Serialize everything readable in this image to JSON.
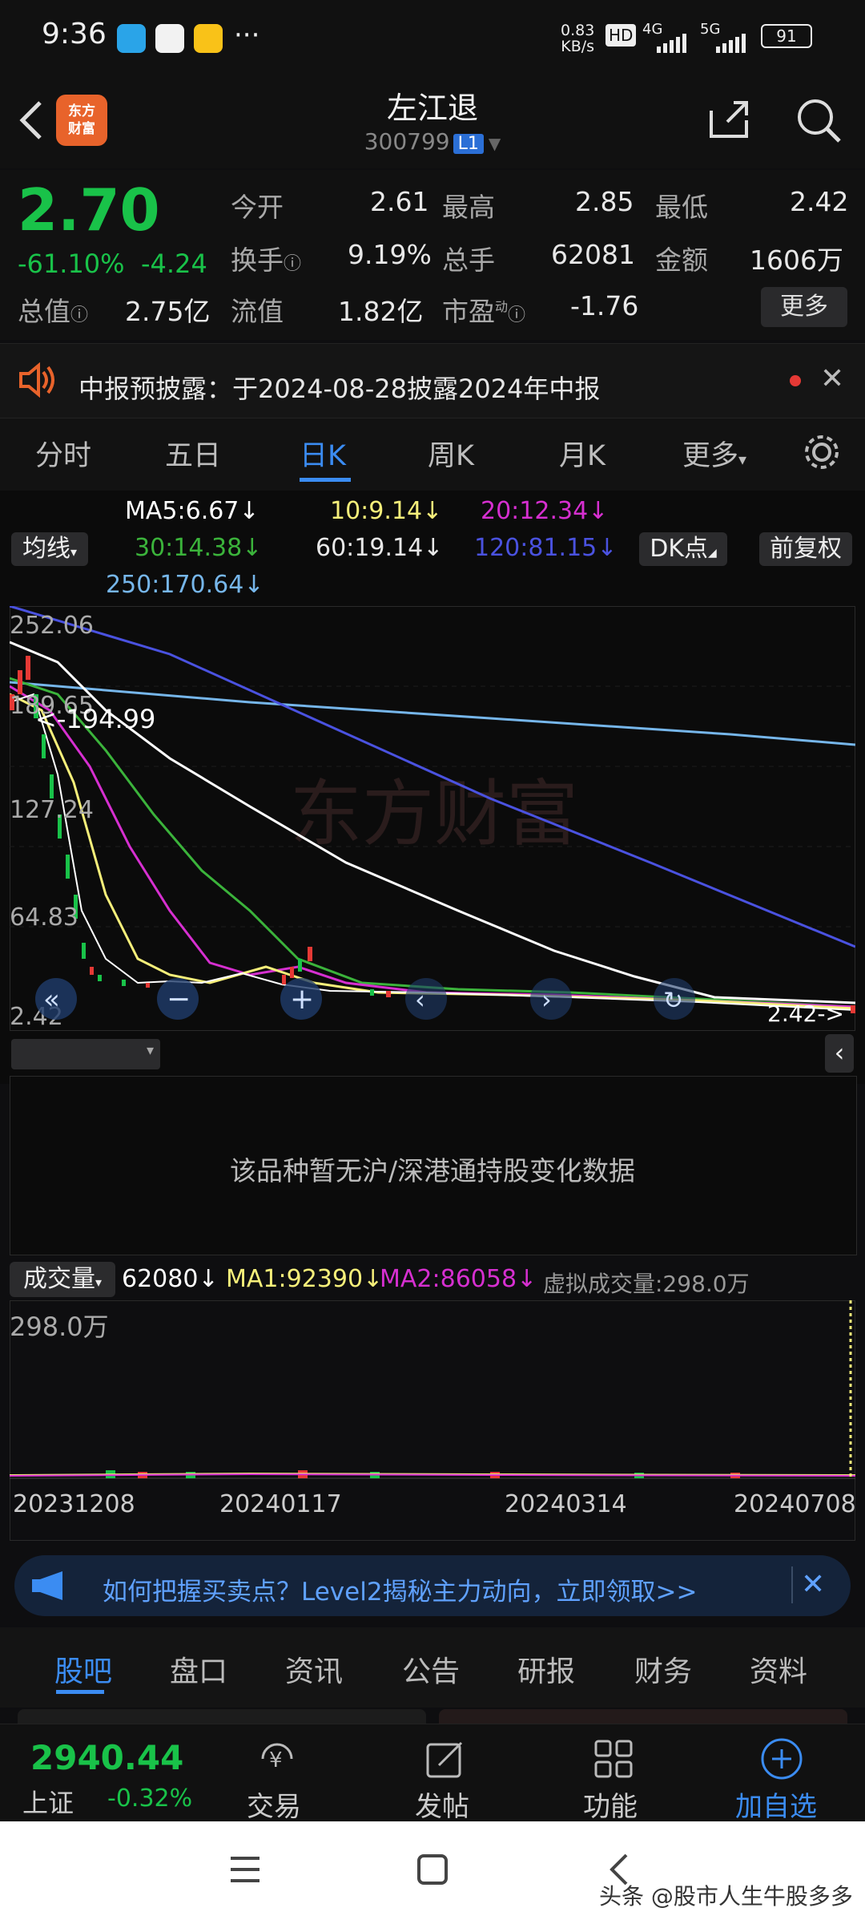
{
  "status_bar": {
    "time": "9:36",
    "net_speed_top": "0.83",
    "net_speed_bottom": "KB/s",
    "hd": "HD",
    "net4g": "4G",
    "net5g": "5G",
    "battery": "91"
  },
  "header": {
    "logo_line1": "东方",
    "logo_line2": "财富",
    "title": "左江退",
    "code": "300799",
    "level": "L1"
  },
  "quote": {
    "price": "2.70",
    "change_pct": "-61.10%",
    "change": "-4.24",
    "open_label": "今开",
    "open": "2.61",
    "high_label": "最高",
    "high": "2.85",
    "low_label": "最低",
    "low": "2.42",
    "turnover_label": "换手",
    "turnover": "9.19%",
    "volume_label": "总手",
    "volume": "62081",
    "amount_label": "金额",
    "amount": "1606万",
    "mktcap_label": "总值",
    "mktcap": "2.75亿",
    "float_label": "流值",
    "float": "1.82亿",
    "pe_label": "市盈",
    "pe_sup": "动",
    "pe": "-1.76",
    "more": "更多"
  },
  "notice": {
    "text": "中报预披露：于2024-08-28披露2024年中报"
  },
  "period_tabs": [
    {
      "label": "分时"
    },
    {
      "label": "五日"
    },
    {
      "label": "日K"
    },
    {
      "label": "周K"
    },
    {
      "label": "月K"
    },
    {
      "label": "更多"
    }
  ],
  "ma_legend": {
    "ma5": "MA5:6.67",
    "ma10": "10:9.14",
    "ma20": "20:12.34",
    "ma30": "30:14.38",
    "ma60": "60:19.14",
    "ma120": "120:81.15",
    "ma250": "250:170.64",
    "indicator": "均线",
    "dk": "DK点",
    "adjust": "前复权"
  },
  "kline": {
    "y_labels": [
      "252.06",
      "189.65",
      "127.24",
      "64.83",
      "2.42"
    ],
    "max_marker": "<-194.99",
    "min_marker": "2.42->",
    "watermark": "东方财富",
    "colors": {
      "ma5": "#ffffff",
      "ma10": "#f6ef7a",
      "ma20": "#d62fd0",
      "ma30": "#3bb33b",
      "ma60": "#ffffff",
      "ma120": "#4a52e0",
      "ma250": "#76b6ea"
    }
  },
  "hk_panel": {
    "message": "该品种暂无沪/深港通持股变化数据"
  },
  "volume": {
    "label": "成交量",
    "value": "62080",
    "ma1": "MA1:92390",
    "ma2": "MA2:86058",
    "virtual": "虚拟成交量:298.0万",
    "max": "298.0万",
    "dates": [
      "20231208",
      "20240117",
      "20240314",
      "20240708"
    ]
  },
  "promo": {
    "text": "如何把握买卖点？Level2揭秘主力动向，立即领取>>"
  },
  "bottom_tabs": [
    {
      "label": "股吧"
    },
    {
      "label": "盘口"
    },
    {
      "label": "资讯"
    },
    {
      "label": "公告"
    },
    {
      "label": "研报"
    },
    {
      "label": "财务"
    },
    {
      "label": "资料"
    }
  ],
  "index": {
    "value": "2940.44",
    "name": "上证",
    "change": "-0.32%"
  },
  "toolbar": [
    {
      "label": "交易",
      "icon": "yen-icon"
    },
    {
      "label": "发帖",
      "icon": "edit-icon"
    },
    {
      "label": "功能",
      "icon": "grid-icon"
    },
    {
      "label": "加自选",
      "icon": "add-icon"
    }
  ],
  "watermark_footer": "头条 @股市人生牛股多多"
}
